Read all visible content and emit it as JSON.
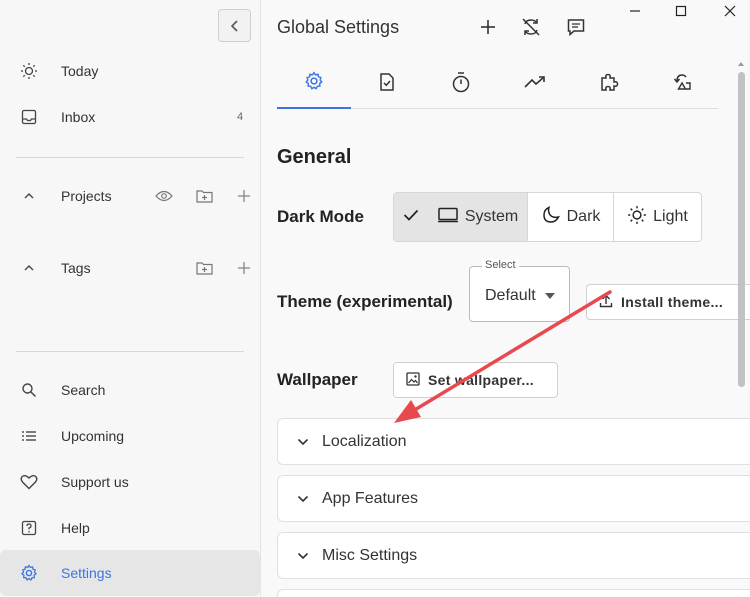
{
  "sidebar": {
    "items": [
      {
        "label": "Today",
        "icon": "sun-icon"
      },
      {
        "label": "Inbox",
        "icon": "inbox-icon",
        "count": "4"
      },
      {
        "label": "Projects",
        "icon": "chevron-up-icon"
      },
      {
        "label": "Tags",
        "icon": "chevron-up-icon"
      },
      {
        "label": "Search",
        "icon": "search-icon"
      },
      {
        "label": "Upcoming",
        "icon": "list-icon"
      },
      {
        "label": "Support us",
        "icon": "heart-icon"
      },
      {
        "label": "Help",
        "icon": "help-icon"
      },
      {
        "label": "Settings",
        "icon": "gear-icon"
      }
    ]
  },
  "header": {
    "title": "Global Settings"
  },
  "tabs": [
    "gear-icon",
    "task-check-icon",
    "timer-icon",
    "trending-icon",
    "puzzle-icon",
    "sync-icon"
  ],
  "general": {
    "title": "General",
    "dark_mode_label": "Dark Mode",
    "dark_mode_options": [
      "System",
      "Dark",
      "Light"
    ],
    "dark_mode_selected": "System",
    "theme_label": "Theme (experimental)",
    "theme_select_legend": "Select",
    "theme_select_value": "Default",
    "install_theme_label": "Install theme...",
    "wallpaper_label": "Wallpaper",
    "set_wallpaper_label": "Set wallpaper..."
  },
  "sections": [
    "Localization",
    "App Features",
    "Misc Settings"
  ],
  "colors": {
    "accent": "#3b76e0",
    "annotation_arrow": "#e8494f"
  }
}
